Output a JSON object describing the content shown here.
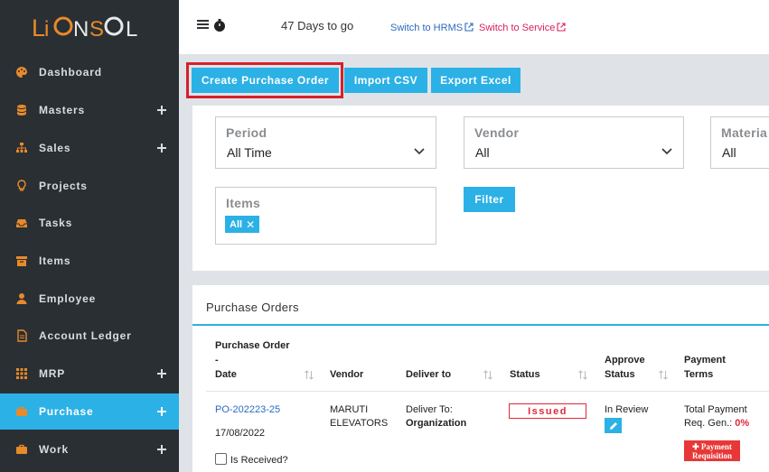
{
  "sidebar": {
    "logo_text": "LIONSOL",
    "items": [
      {
        "label": "Dashboard",
        "icon": "palette-icon",
        "has_plus": false,
        "active": false
      },
      {
        "label": "Masters",
        "icon": "database-icon",
        "has_plus": true,
        "active": false
      },
      {
        "label": "Sales",
        "icon": "sitemap-icon",
        "has_plus": true,
        "active": false
      },
      {
        "label": "Projects",
        "icon": "lightbulb-icon",
        "has_plus": false,
        "active": false
      },
      {
        "label": "Tasks",
        "icon": "inbox-icon",
        "has_plus": false,
        "active": false
      },
      {
        "label": "Items",
        "icon": "archive-icon",
        "has_plus": false,
        "active": false
      },
      {
        "label": "Employee",
        "icon": "user-icon",
        "has_plus": false,
        "active": false
      },
      {
        "label": "Account Ledger",
        "icon": "document-icon",
        "has_plus": false,
        "active": false
      },
      {
        "label": "MRP",
        "icon": "grid-icon",
        "has_plus": true,
        "active": false
      },
      {
        "label": "Purchase",
        "icon": "briefcase-icon",
        "has_plus": true,
        "active": true
      },
      {
        "label": "Work",
        "icon": "briefcase-icon",
        "has_plus": true,
        "active": false
      }
    ]
  },
  "topbar": {
    "days_left": "47 Days to go",
    "switch_hrms": "Switch to HRMS",
    "switch_service": "Switch to Service"
  },
  "toolbar": {
    "create_po": "Create Purchase Order",
    "import_csv": "Import CSV",
    "export_excel": "Export Excel"
  },
  "filters": {
    "period": {
      "label": "Period",
      "value": "All Time"
    },
    "vendor": {
      "label": "Vendor",
      "value": "All"
    },
    "material": {
      "label": "Materia",
      "value": "All"
    },
    "items": {
      "label": "Items",
      "chip": "All"
    },
    "filter_button": "Filter"
  },
  "orders": {
    "title": "Purchase Orders",
    "headers": {
      "po_line1": "Purchase Order",
      "po_line2": "-",
      "po_line3": "Date",
      "vendor": "Vendor",
      "deliver_to": "Deliver to",
      "status": "Status",
      "approve_line1": "Approve",
      "approve_line2": "Status",
      "payment_line1": "Payment",
      "payment_line2": "Terms"
    },
    "row": {
      "po_number": "PO-202223-25",
      "date": "17/08/2022",
      "is_received": "Is Received?",
      "vendor_line1": "MARUTI",
      "vendor_line2": "ELEVATORS",
      "deliver_line1": "Deliver To:",
      "deliver_line2": "Organization",
      "status": "Issued",
      "approve_status": "In Review",
      "payment_line1": "Total Payment",
      "payment_line2": "Req. Gen.:",
      "payment_pct": "0%",
      "pay_req_line1": "✚ Payment",
      "pay_req_line2": "Requisition"
    }
  },
  "colors": {
    "accent": "#2bb1e5",
    "sidebar_bg": "#2a2f33",
    "danger": "#e0273a"
  }
}
